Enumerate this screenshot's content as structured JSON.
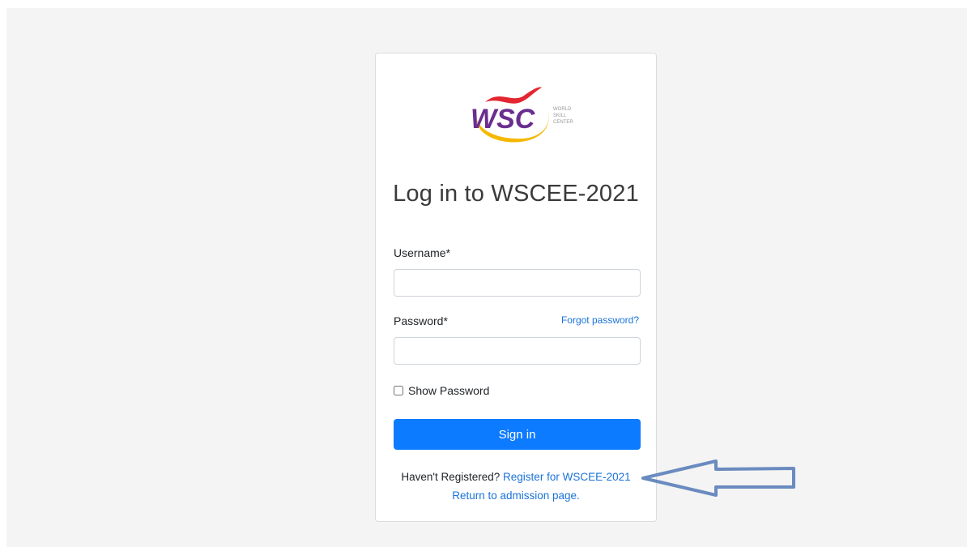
{
  "login": {
    "title": "Log in to WSCEE-2021",
    "username_label": "Username*",
    "username_value": "",
    "password_label": "Password*",
    "password_value": "",
    "forgot_password": "Forgot password?",
    "show_password": "Show Password",
    "sign_in": "Sign in",
    "register_prompt": "Haven't Registered?",
    "register_link": "Register for WSCEE-2021",
    "return_link": "Return to admission page."
  },
  "logo": {
    "text": "WSC",
    "tagline_lines": [
      "WORLD",
      "SKILL",
      "CENTER"
    ]
  },
  "colors": {
    "primary": "#0d7bff",
    "link": "#1a73d9",
    "logo_purple": "#6b2d8f",
    "logo_red": "#e3262f",
    "logo_yellow": "#f5b800",
    "arrow": "#6a8bbf"
  }
}
